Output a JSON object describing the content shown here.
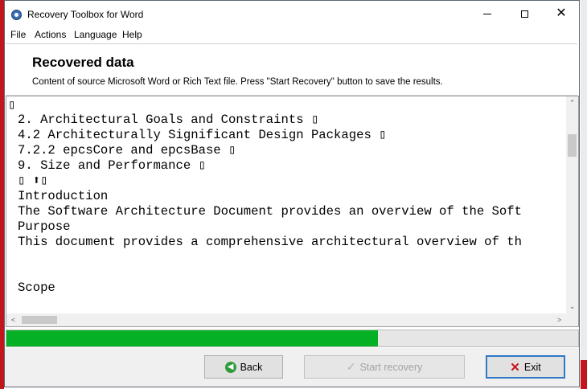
{
  "window": {
    "title": "Recovery Toolbox for Word",
    "controls": {
      "minimize": "—",
      "maximize": "☐",
      "close": "✕"
    }
  },
  "menu": [
    "File",
    "Actions",
    "Language",
    "Help"
  ],
  "header": {
    "title": "Recovered data",
    "subtitle": "Content of source Microsoft Word or Rich Text file. Press \"Start Recovery\" button to save the results."
  },
  "editor": {
    "lines": [
      "▯",
      "2. Architectural Goals and Constraints ▯",
      "4.2 Architecturally Significant Design Packages ▯",
      "7.2.2 epcsCore and epcsBase ▯",
      "9. Size and Performance ▯",
      "▯ ⬆▯",
      "Introduction",
      "The Software Architecture Document provides an overview of the Soft",
      "Purpose",
      "This document provides a comprehensive architectural overview of th",
      "",
      "",
      "Scope"
    ],
    "scroll": {
      "up": "⌃",
      "down": "⌄",
      "left": "<",
      "right": ">"
    }
  },
  "progress": {
    "value_percent": 65,
    "color": "#06b025"
  },
  "buttons": {
    "back": "Back",
    "start_recovery": "Start recovery",
    "exit": "Exit"
  },
  "icons": {
    "back": "back-arrow-circle-icon",
    "start": "checkmark-icon",
    "exit": "red-x-icon"
  }
}
